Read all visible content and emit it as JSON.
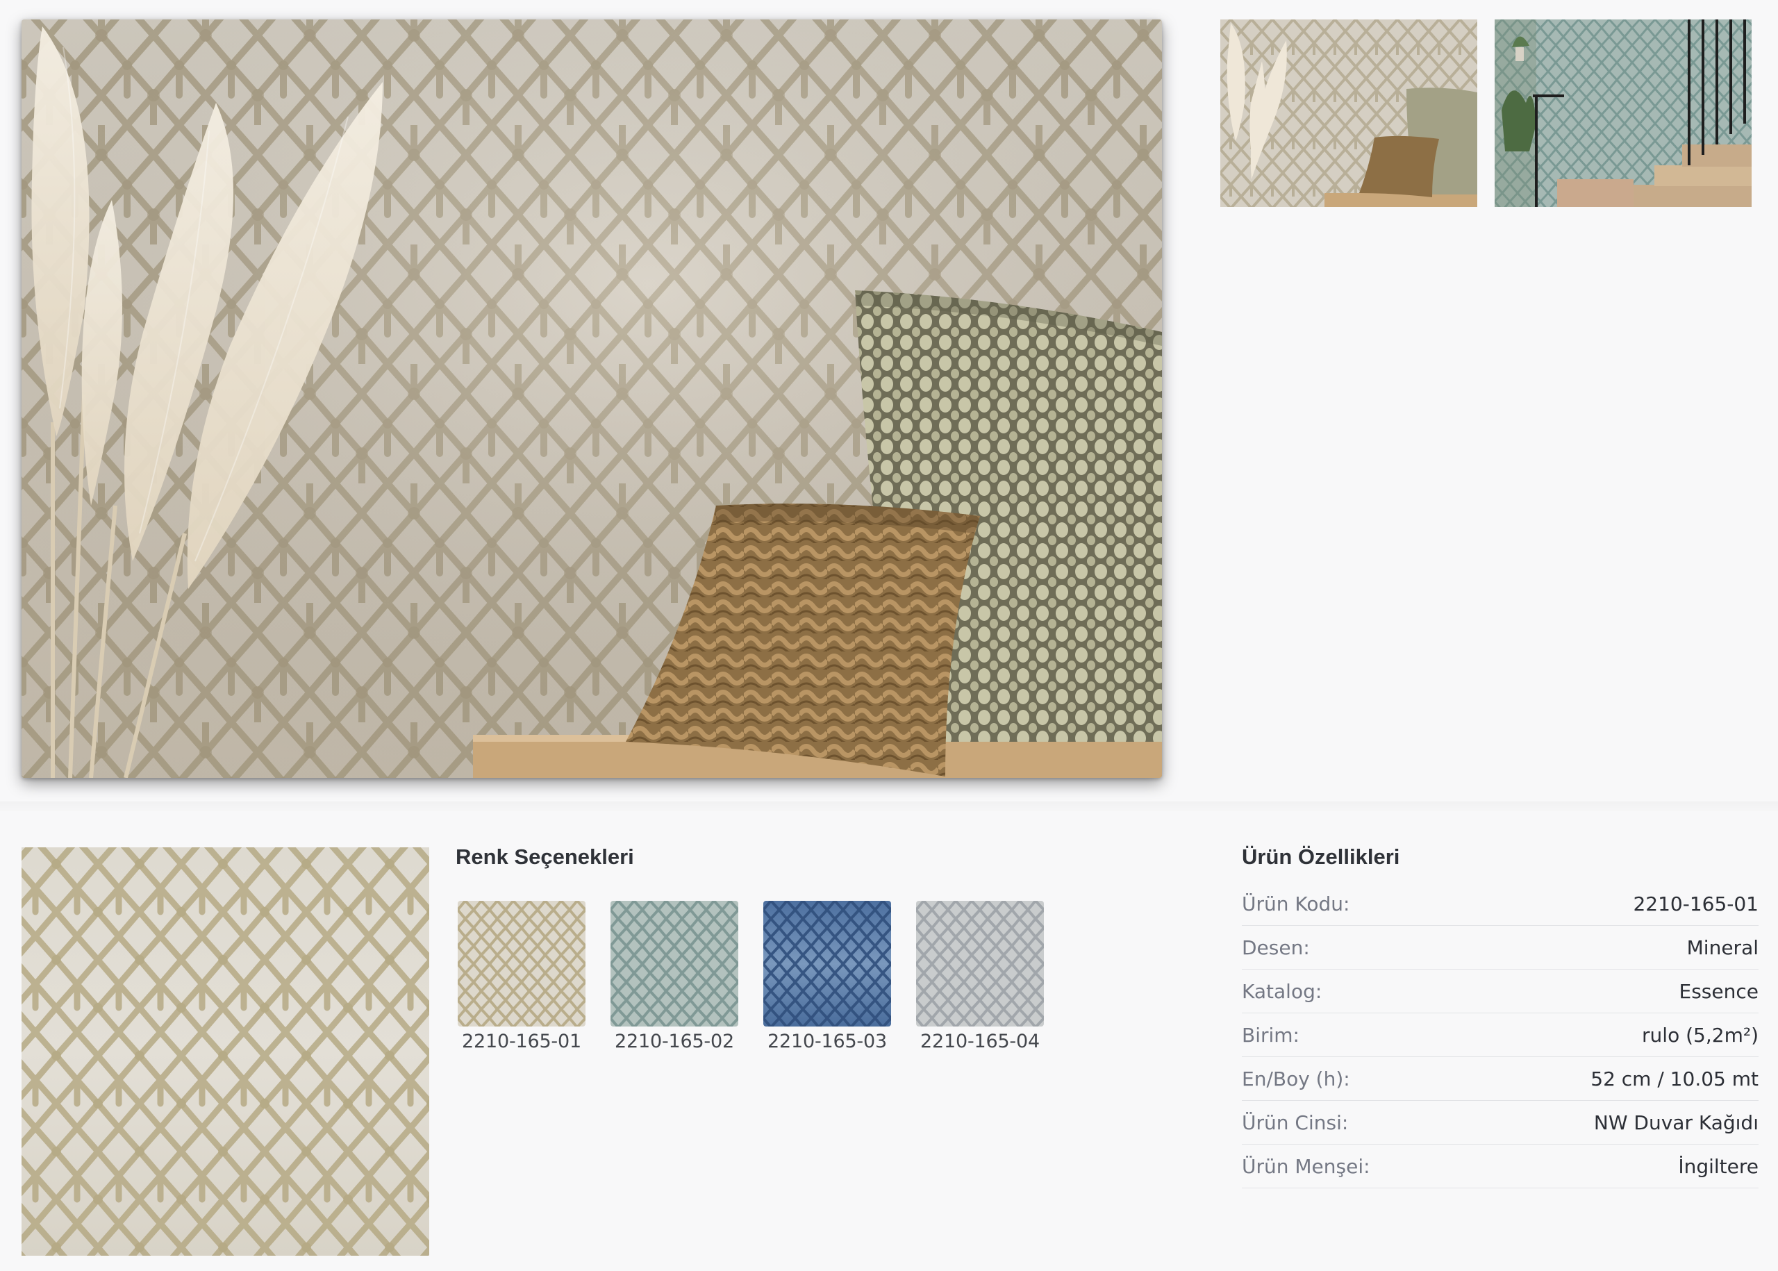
{
  "gallery": {
    "main_image": "wallpaper-room-pillows-pampas",
    "thumbnails": [
      "wallpaper-room-pillows-thumb",
      "wallpaper-staircase-teal-thumb"
    ]
  },
  "color_options": {
    "title": "Renk Seçenekleri",
    "items": [
      {
        "code": "2210-165-01",
        "color": "#c3b79c"
      },
      {
        "code": "2210-165-02",
        "color": "#9fb0ac"
      },
      {
        "code": "2210-165-03",
        "color": "#5277a6"
      },
      {
        "code": "2210-165-04",
        "color": "#b5b9bc"
      }
    ]
  },
  "product_specs": {
    "title": "Ürün Özellikleri",
    "rows": [
      {
        "label": "Ürün Kodu:",
        "value": "2210-165-01"
      },
      {
        "label": "Desen:",
        "value": "Mineral"
      },
      {
        "label": "Katalog:",
        "value": "Essence"
      },
      {
        "label": "Birim:",
        "value": "rulo (5,2m²)"
      },
      {
        "label": "En/Boy (h):",
        "value": "52 cm / 10.05 mt"
      },
      {
        "label": "Ürün Cinsi:",
        "value": "NW Duvar Kağıdı"
      },
      {
        "label": "Ürün Menşei:",
        "value": "İngiltere"
      }
    ]
  }
}
